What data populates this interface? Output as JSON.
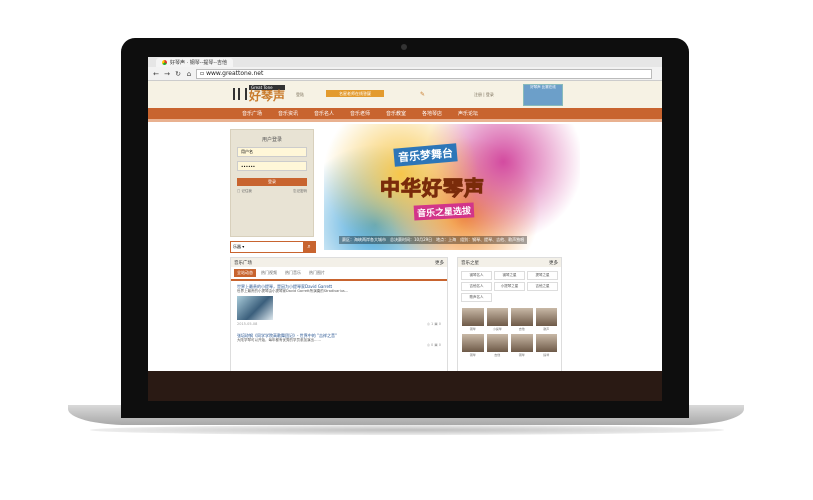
{
  "browser": {
    "tab_title": "好琴声 · 钢琴--提琴--吉他",
    "url": "www.greattone.net"
  },
  "site": {
    "logo_en": "Great Tone",
    "logo_cn": "好琴声",
    "header_link_left": "登陆",
    "promo_button": "名星老师在线答疑",
    "header_link_right": "注册 | 登录",
    "ad_badge": "好琴声 比赛在线"
  },
  "nav": [
    "音乐广场",
    "音乐资讯",
    "音乐名人",
    "音乐老师",
    "音乐教室",
    "各地琴店",
    "声乐论坛"
  ],
  "login": {
    "title": "用户登录",
    "username": "用户名",
    "password": "••••••",
    "submit": "登录",
    "remember": "□ 记住我",
    "forgot": "忘记密码"
  },
  "search": {
    "select": "乐器 ▾",
    "go": "⌕"
  },
  "banner": {
    "t1": "音乐梦舞台",
    "t2": "中华好琴声",
    "t3": "音乐之星选拔",
    "caption": "赛区：海峡两岸各大城市　总决赛时间：10月29日　地点：上海　组别：钢琴、提琴、吉他、歌声独唱"
  },
  "square": {
    "title": "音乐广场",
    "more": "更多",
    "tabs": [
      "全站动态",
      "热门视频",
      "热门音乐",
      "热门图片"
    ],
    "posts": [
      {
        "title": "世界上最贵的小提琴，是因为小提琴家David Garrett",
        "body": "世界上最贵的小提琴由小提琴家David Garrett所演奏的Stradivarius…",
        "date": "2015-05-08",
        "stats": "◎ 1  ▣ 0"
      },
      {
        "title": "张培琼钢《同学学院高歌舞团记》- 世界中的 “吉祥之音\"",
        "body": "大陆学琴可以开始，每年都有优秀的学员参加演出……",
        "date": "",
        "stats": "◎ 0  ▣ 0"
      }
    ]
  },
  "road": {
    "title": "音乐之星",
    "more": "更多",
    "tags": [
      "钢琴名人",
      "钢琴之星",
      "提琴之星",
      "吉他名人",
      "小提琴之星",
      "吉他之星",
      "歌声名人",
      "",
      ""
    ],
    "avatars": [
      "钢琴",
      "小提琴",
      "吉他",
      "歌声",
      "钢琴",
      "吉他",
      "钢琴",
      "提琴"
    ]
  }
}
